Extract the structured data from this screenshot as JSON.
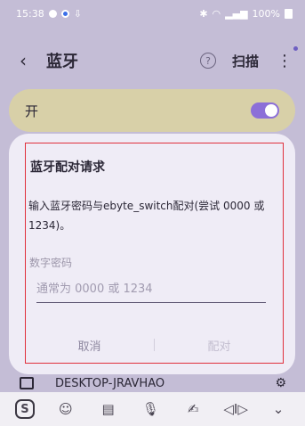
{
  "status_bar": {
    "time": "15:38",
    "battery": "100%"
  },
  "app_bar": {
    "back_glyph": "‹",
    "title": "蓝牙",
    "help_glyph": "?",
    "scan_label": "扫描",
    "more_glyph": "⋮"
  },
  "toggle": {
    "label": "开",
    "state": "on"
  },
  "device": {
    "name": "DESKTOP-JRAVHAO",
    "gear_glyph": "⚙"
  },
  "dialog": {
    "title": "蓝牙配对请求",
    "message": "输入蓝牙密码与ebyte_switch配对(尝试 0000 或 1234)。",
    "field_label": "数字密码",
    "input_value": "",
    "input_placeholder": "通常为 0000 或 1234",
    "cancel_label": "取消",
    "pair_label": "配对"
  },
  "keyboard_toolbar": {
    "swift_glyph": "S",
    "emoji_glyph": "☺",
    "clipboard_glyph": "▤",
    "mic_glyph": "🎙",
    "handwriting_glyph": "✍",
    "cursor_glyph": "◁I▷",
    "collapse_glyph": "⌄"
  },
  "colors": {
    "background": "#c4bdd6",
    "toggle_row": "#d8d0a8",
    "toggle_on": "#8c6fd8",
    "dialog_bg": "#efecf6",
    "highlight_outline": "#e0303c"
  }
}
